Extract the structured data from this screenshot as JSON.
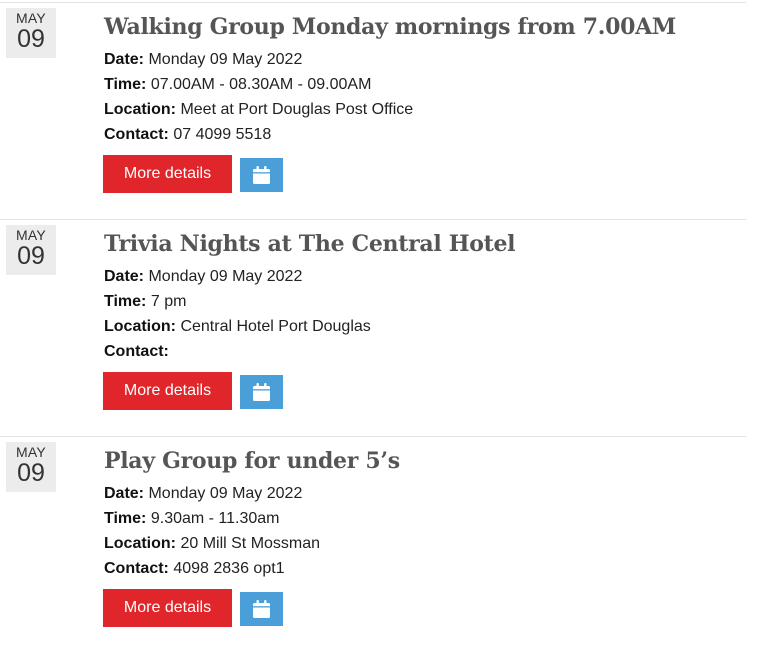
{
  "labels": {
    "date": "Date:",
    "time": "Time:",
    "location": "Location:",
    "contact": "Contact:",
    "more_details": "More details"
  },
  "icons": {
    "calendar": "calendar-icon"
  },
  "colors": {
    "button_red": "#e1262b",
    "button_blue": "#4a9fd8",
    "badge_bg": "#ececec",
    "title": "#555555"
  },
  "events": [
    {
      "month": "MAY",
      "day": "09",
      "title": "Walking Group Monday mornings from 7.00AM",
      "date": "Monday 09 May 2022",
      "time": "07.00AM - 08.30AM - 09.00AM",
      "location": "Meet at Port Douglas Post Office",
      "contact": "07 4099 5518"
    },
    {
      "month": "MAY",
      "day": "09",
      "title": "Trivia Nights at The Central Hotel",
      "date": "Monday 09 May 2022",
      "time": "7 pm",
      "location": "Central Hotel Port Douglas",
      "contact": ""
    },
    {
      "month": "MAY",
      "day": "09",
      "title": "Play Group for under 5’s",
      "date": "Monday 09 May 2022",
      "time": "9.30am - 11.30am",
      "location": "20 Mill St Mossman",
      "contact": "4098 2836 opt1"
    }
  ]
}
